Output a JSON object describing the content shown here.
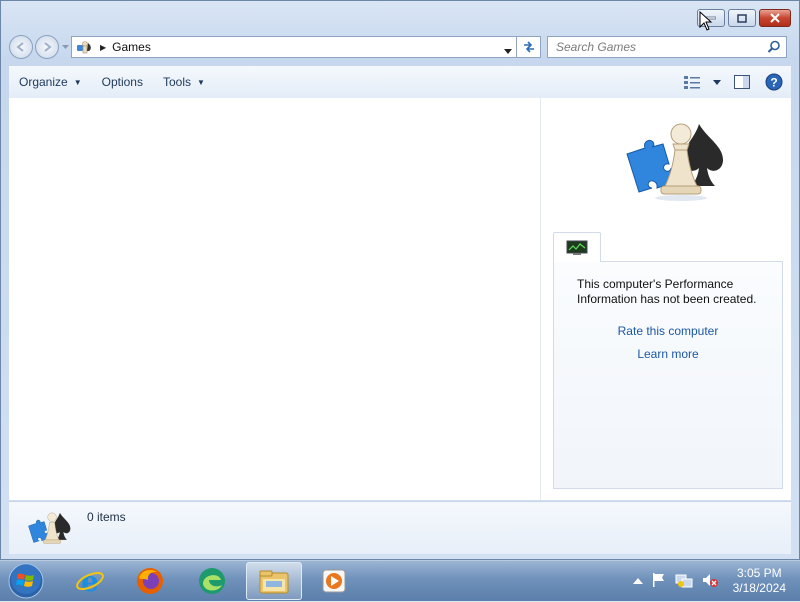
{
  "window": {
    "caption_buttons": {
      "minimize": "minimize",
      "maximize": "maximize",
      "close": "close"
    }
  },
  "address_bar": {
    "location": "Games",
    "search_placeholder": "Search Games"
  },
  "toolbar": {
    "organize": "Organize",
    "options": "Options",
    "tools": "Tools"
  },
  "perf_panel": {
    "message": "This computer's Performance Information has not been created.",
    "rate_link": "Rate this computer",
    "learn_link": "Learn more"
  },
  "details": {
    "item_count": "0 items"
  },
  "taskbar": {
    "clock_time": "3:05 PM",
    "clock_date": "3/18/2024"
  },
  "colors": {
    "link": "#1c58a4",
    "close_red": "#c8452f",
    "taskbar": "#6f91ba"
  }
}
